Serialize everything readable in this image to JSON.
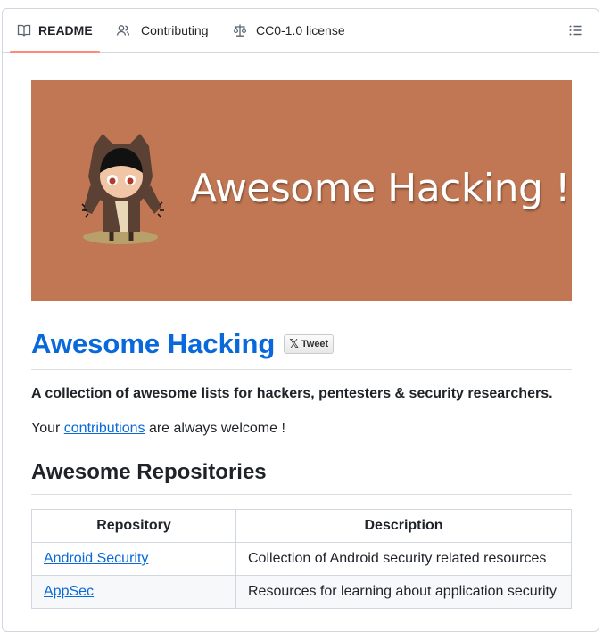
{
  "tabs": [
    {
      "label": "README",
      "icon": "book-icon",
      "active": true
    },
    {
      "label": "Contributing",
      "icon": "people-icon",
      "active": false
    },
    {
      "label": "CC0-1.0 license",
      "icon": "law-icon",
      "active": false
    }
  ],
  "banner": {
    "title": "Awesome Hacking !"
  },
  "readme": {
    "title": "Awesome Hacking",
    "tweet_label": "Tweet",
    "intro": "A collection of awesome lists for hackers, pentesters & security researchers.",
    "welcome_prefix": "Your ",
    "welcome_link": "contributions",
    "welcome_suffix": " are always welcome !",
    "section_title": "Awesome Repositories"
  },
  "table": {
    "headers": [
      "Repository",
      "Description"
    ],
    "rows": [
      {
        "repo": "Android Security",
        "description": "Collection of Android security related resources"
      },
      {
        "repo": "AppSec",
        "description": "Resources for learning about application security"
      }
    ]
  },
  "colors": {
    "accent": "#0969da",
    "tab_underline": "#fd8c73",
    "banner_bg": "#c17753"
  }
}
